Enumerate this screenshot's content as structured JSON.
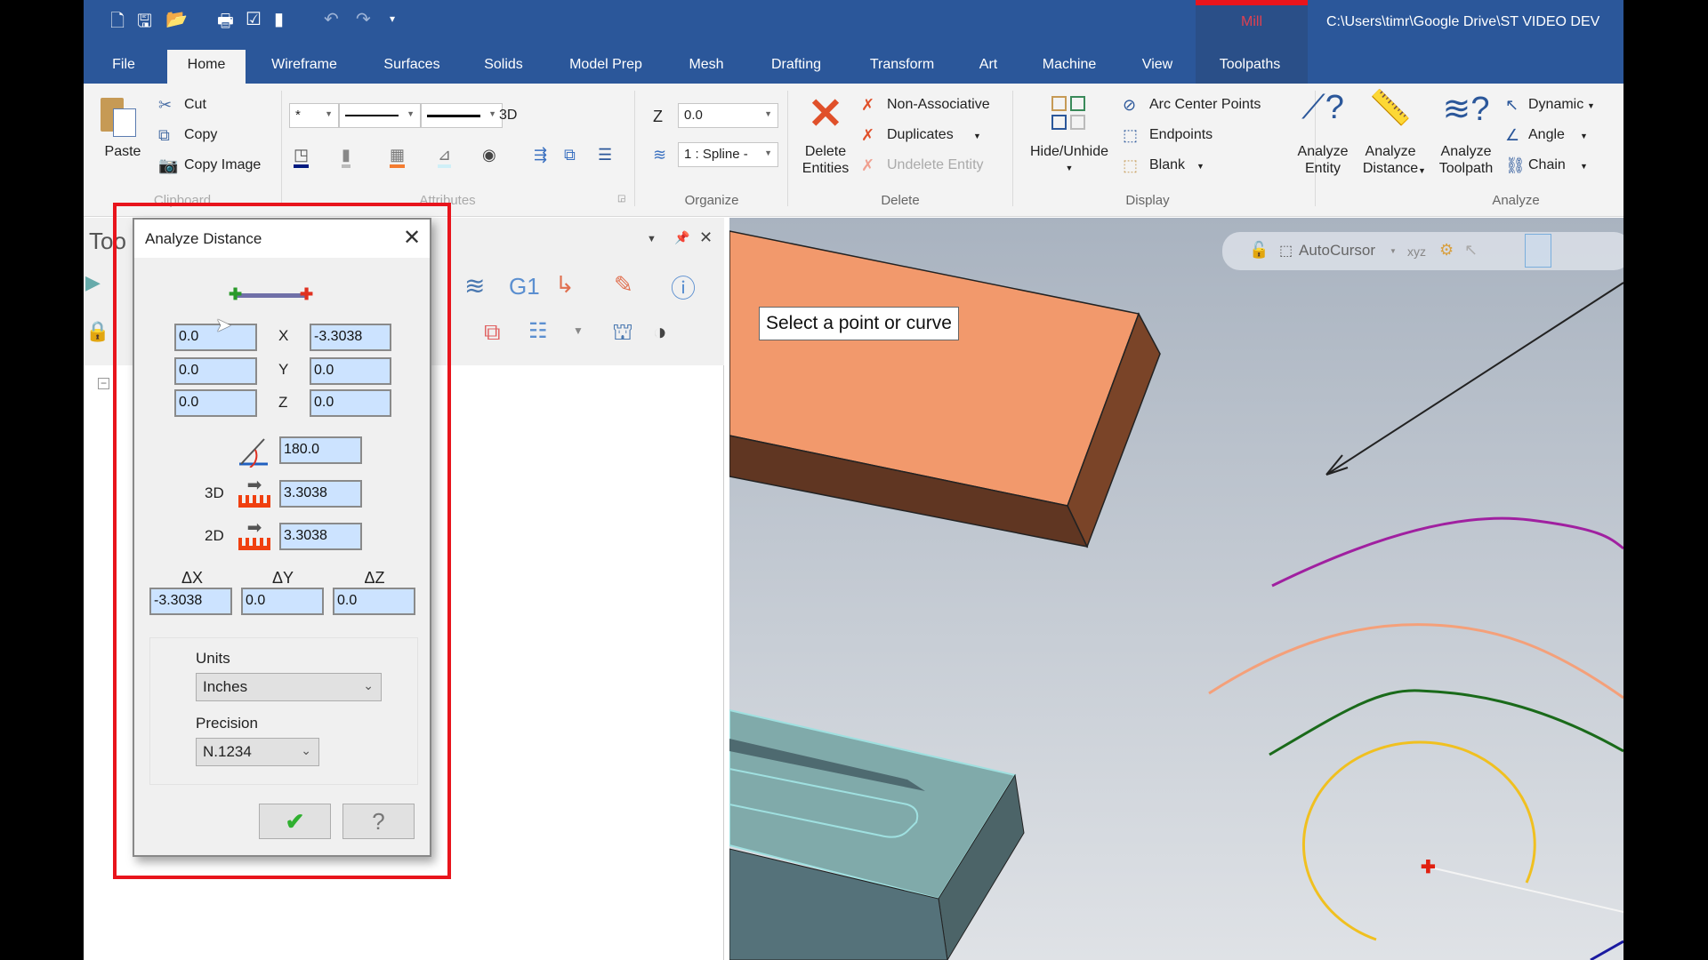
{
  "titlebar": {
    "context_tab": "Mill",
    "file_path": "C:\\Users\\timr\\Google Drive\\ST VIDEO DEV",
    "quick_access": [
      "new-icon",
      "save-icon",
      "open-icon",
      "print-icon",
      "save-as-icon",
      "bookmark-icon",
      "undo-icon",
      "redo-icon",
      "customize-icon"
    ]
  },
  "tabs": [
    "File",
    "Home",
    "Wireframe",
    "Surfaces",
    "Solids",
    "Model Prep",
    "Mesh",
    "Drafting",
    "Transform",
    "Art",
    "Machine",
    "View",
    "Toolpaths"
  ],
  "active_tab": "Home",
  "ribbon": {
    "clipboard": {
      "label": "Clipboard",
      "paste": "Paste",
      "cut": "Cut",
      "copy": "Copy",
      "copy_image": "Copy Image"
    },
    "attributes": {
      "label": "Attributes",
      "mode": "3D",
      "point_style": "*"
    },
    "organize": {
      "label": "Organize",
      "z_label": "Z",
      "z_value": "0.0",
      "level": "1 : Spline -"
    },
    "delete": {
      "label": "Delete",
      "delete_entities": [
        "Delete",
        "Entities"
      ],
      "non_associative": "Non-Associative",
      "duplicates": "Duplicates",
      "undelete": "Undelete Entity"
    },
    "display": {
      "label": "Display",
      "hide_unhide": "Hide/Unhide",
      "arc_center": "Arc Center Points",
      "endpoints": "Endpoints",
      "blank": "Blank"
    },
    "analyze": {
      "label": "Analyze",
      "entity": [
        "Analyze",
        "Entity"
      ],
      "distance": [
        "Analyze",
        "Distance"
      ],
      "toolpath": [
        "Analyze",
        "Toolpath"
      ],
      "dynamic": "Dynamic",
      "angle": "Angle",
      "chain": "Chain"
    }
  },
  "panel": {
    "title": "Too",
    "g1": "G1"
  },
  "dialog": {
    "title": "Analyze Distance",
    "p1": {
      "x": "0.0",
      "y": "0.0",
      "z": "0.0"
    },
    "p2": {
      "x": "-3.3038",
      "y": "0.0",
      "z": "0.0"
    },
    "axis_labels": {
      "x": "X",
      "y": "Y",
      "z": "Z"
    },
    "angle": "180.0",
    "d3_label": "3D",
    "d3": "3.3038",
    "d2_label": "2D",
    "d2": "3.3038",
    "delta_labels": {
      "dx": "ΔX",
      "dy": "ΔY",
      "dz": "ΔZ"
    },
    "delta": {
      "dx": "-3.3038",
      "dy": "0.0",
      "dz": "0.0"
    },
    "units_label": "Units",
    "units": "Inches",
    "precision_label": "Precision",
    "precision": "N.1234"
  },
  "viewport": {
    "prompt": "Select a point or curve",
    "autocursor": "AutoCursor",
    "xyz": "xyz"
  },
  "colors": {
    "ribbon_blue": "#2b579a",
    "highlight_red": "#e8141c",
    "field_blue": "#cce3ff",
    "orange_block": "#f2996c",
    "teal_block": "#7fa9a9"
  }
}
